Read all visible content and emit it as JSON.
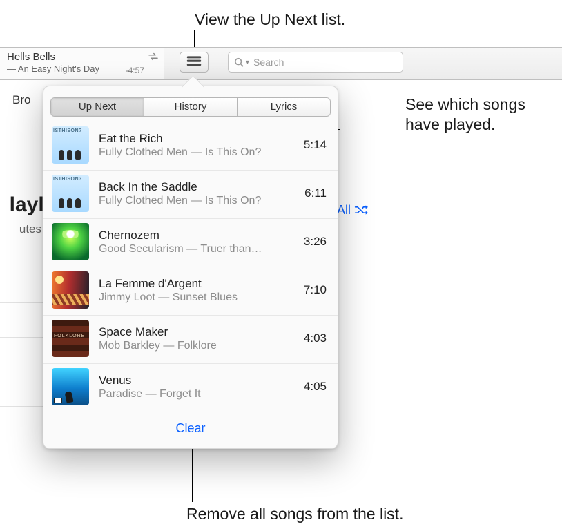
{
  "callouts": {
    "top": "View the Up Next list.",
    "right_line1": "See which songs",
    "right_line2": "have played.",
    "bottom": "Remove all songs from the list."
  },
  "toolbar": {
    "now_playing_title": "Hells Bells",
    "now_playing_subtitle": "— An Easy Night's Day",
    "time_remaining": "-4:57",
    "search_placeholder": "Search"
  },
  "background": {
    "browse_label": "Bro",
    "playlist_fragment": "layli",
    "utes_fragment": "utes",
    "shuffle_all_label": "All"
  },
  "popover": {
    "tabs": {
      "up_next": "Up Next",
      "history": "History",
      "lyrics": "Lyrics"
    },
    "clear_label": "Clear",
    "songs": [
      {
        "title": "Eat the Rich",
        "subtitle": "Fully Clothed Men — Is This On?",
        "duration": "5:14",
        "art": "art1"
      },
      {
        "title": "Back In the Saddle",
        "subtitle": "Fully Clothed Men — Is This On?",
        "duration": "6:11",
        "art": "art1"
      },
      {
        "title": "Chernozem",
        "subtitle": "Good Secularism — Truer than…",
        "duration": "3:26",
        "art": "art3"
      },
      {
        "title": "La Femme d'Argent",
        "subtitle": "Jimmy Loot — Sunset Blues",
        "duration": "7:10",
        "art": "art4"
      },
      {
        "title": "Space Maker",
        "subtitle": "Mob Barkley — Folklore",
        "duration": "4:03",
        "art": "art5"
      },
      {
        "title": "Venus",
        "subtitle": "Paradise — Forget It",
        "duration": "4:05",
        "art": "art6"
      }
    ]
  }
}
